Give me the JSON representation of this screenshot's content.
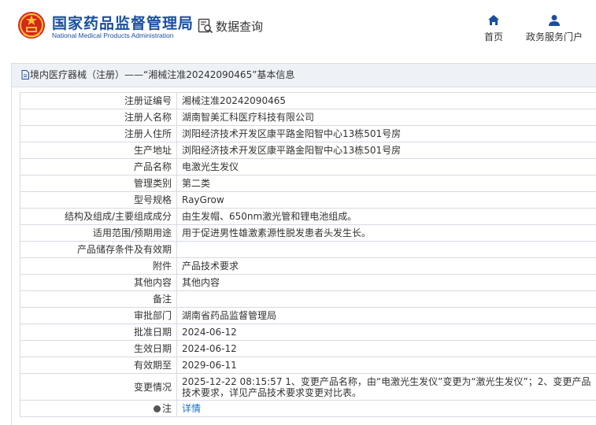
{
  "header": {
    "org_name_cn": "国家药品监督管理局",
    "org_name_en": "National Medical Products Administration",
    "search_title": "数据查询",
    "nav": [
      {
        "label": "首页",
        "icon": "home-icon"
      },
      {
        "label": "政务服务门户",
        "icon": "user-icon"
      }
    ]
  },
  "panel": {
    "title": "境内医疗器械（注册）——“湘械注准20242090465”基本信息"
  },
  "rows": [
    {
      "label": "注册证编号",
      "value": "湘械注准20242090465"
    },
    {
      "label": "注册人名称",
      "value": "湖南智美汇科医疗科技有限公司"
    },
    {
      "label": "注册人住所",
      "value": "浏阳经济技术开发区康平路金阳智中心13栋501号房"
    },
    {
      "label": "生产地址",
      "value": "浏阳经济技术开发区康平路金阳智中心13栋501号房"
    },
    {
      "label": "产品名称",
      "value": "电激光生发仪"
    },
    {
      "label": "管理类别",
      "value": "第二类"
    },
    {
      "label": "型号规格",
      "value": "RayGrow"
    },
    {
      "label": "结构及组成/主要组成成分",
      "value": "由生发帽、650nm激光管和锂电池组成。"
    },
    {
      "label": "适用范围/预期用途",
      "value": "用于促进男性雄激素源性脱发患者头发生长。"
    },
    {
      "label": "产品储存条件及有效期",
      "value": ""
    },
    {
      "label": "附件",
      "value": "产品技术要求"
    },
    {
      "label": "其他内容",
      "value": "其他内容"
    },
    {
      "label": "备注",
      "value": ""
    },
    {
      "label": "审批部门",
      "value": "湖南省药品监督管理局"
    },
    {
      "label": "批准日期",
      "value": "2024-06-12"
    },
    {
      "label": "生效日期",
      "value": "2024-06-12"
    },
    {
      "label": "有效期至",
      "value": "2029-06-11"
    },
    {
      "label": "变更情况",
      "value": "2025-12-22 08:15:57 1、变更产品名称，由“电激光生发仪”变更为“激光生发仪”；2、变更产品技术要求，详见产品技术要求变更对比表。"
    },
    {
      "label": "注",
      "value": "详情"
    }
  ],
  "colors": {
    "brand_blue": "#1a4fa0",
    "link_blue": "#1a6fc4",
    "header_bg": "#eef2f7"
  }
}
